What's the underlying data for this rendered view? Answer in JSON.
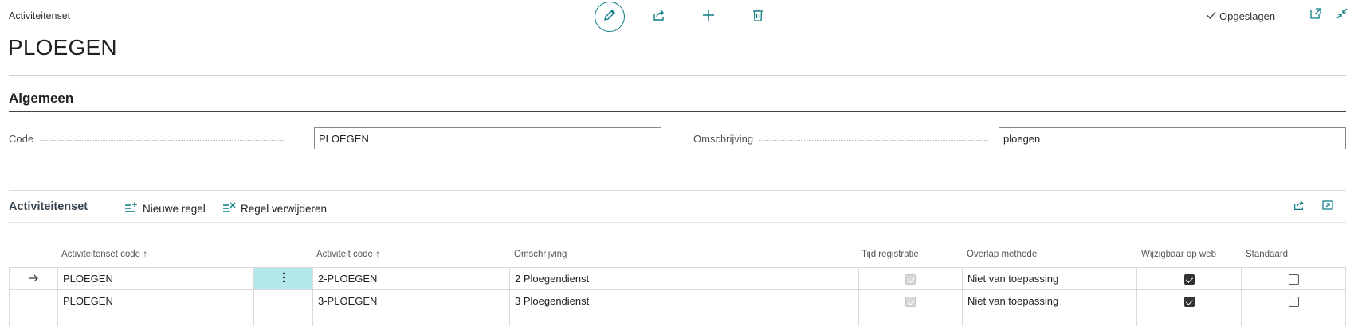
{
  "header": {
    "caption": "Activiteitenset",
    "title": "PLOEGEN",
    "saved_label": "Opgeslagen"
  },
  "toolbar": {
    "icons": [
      "edit-icon",
      "share-icon",
      "add-icon",
      "delete-icon"
    ]
  },
  "general": {
    "section_title": "Algemeen",
    "code_label": "Code",
    "code_value": "PLOEGEN",
    "description_label": "Omschrijving",
    "description_value": "ploegen"
  },
  "lines": {
    "title": "Activiteitenset",
    "new_line_label": "Nieuwe regel",
    "delete_line_label": "Regel verwijderen",
    "columns": {
      "set_code": "Activiteitenset code",
      "activity_code": "Activiteit code",
      "description": "Omschrijving",
      "time_registration": "Tijd registratie",
      "overlap_method": "Overlap methode",
      "editable_web": "Wijzigbaar op web",
      "default": "Standaard"
    },
    "sort_arrow": "↑",
    "rows": [
      {
        "set_code": "PLOEGEN",
        "activity_code": "2-PLOEGEN",
        "description": "2 Ploegendienst",
        "time_registration": true,
        "overlap_method": "Niet van toepassing",
        "editable_web": true,
        "default": false
      },
      {
        "set_code": "PLOEGEN",
        "activity_code": "3-PLOEGEN",
        "description": "3 Ploegendienst",
        "time_registration": true,
        "overlap_method": "Niet van toepassing",
        "editable_web": true,
        "default": false
      }
    ]
  },
  "colors": {
    "accent": "#0a7c82",
    "context_cell": "#b2e8ec"
  }
}
